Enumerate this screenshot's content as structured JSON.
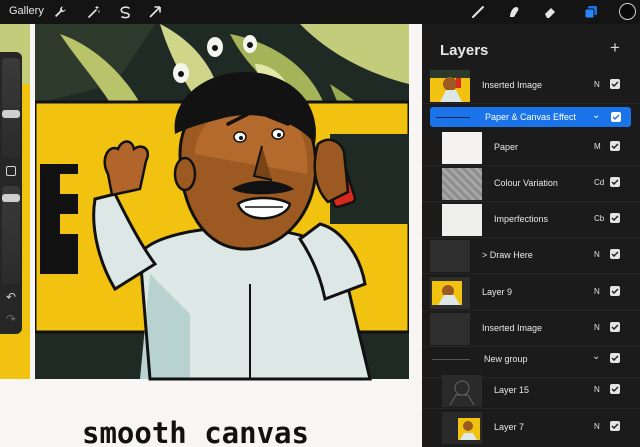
{
  "toolbar": {
    "gallery_label": "Gallery",
    "left_tools": [
      "wrench-icon",
      "magic-wand-icon",
      "selection-icon",
      "transform-arrow-icon"
    ],
    "right_tools": [
      "brush-icon",
      "smudge-icon",
      "eraser-icon",
      "layers-icon"
    ],
    "accent_color": "#1a73e8",
    "current_color": "#0a0a0a"
  },
  "canvas": {
    "caption": "smooth canvas"
  },
  "layers_panel": {
    "title": "Layers",
    "add_label": "+",
    "items": [
      {
        "name": "Inserted Image",
        "mode": "N",
        "visible": true,
        "thumb": "character"
      },
      {
        "name": "Paper & Canvas Effect",
        "mode": "",
        "visible": true,
        "thumb": "group",
        "selected": true
      },
      {
        "name": "Paper",
        "mode": "M",
        "visible": true,
        "thumb": "paper"
      },
      {
        "name": "Colour Variation",
        "mode": "Cd",
        "visible": true,
        "thumb": "texture"
      },
      {
        "name": "Imperfections",
        "mode": "Cb",
        "visible": true,
        "thumb": "paper"
      },
      {
        "name": "> Draw Here",
        "mode": "N",
        "visible": true,
        "thumb": "blank"
      },
      {
        "name": "Layer 9",
        "mode": "N",
        "visible": true,
        "thumb": "character"
      },
      {
        "name": "Inserted Image",
        "mode": "N",
        "visible": true,
        "thumb": "blank"
      },
      {
        "name": "New group",
        "mode": "",
        "visible": true,
        "thumb": "group"
      },
      {
        "name": "Layer 15",
        "mode": "N",
        "visible": true,
        "thumb": "sketch"
      },
      {
        "name": "Layer 7",
        "mode": "N",
        "visible": true,
        "thumb": "character"
      }
    ]
  }
}
